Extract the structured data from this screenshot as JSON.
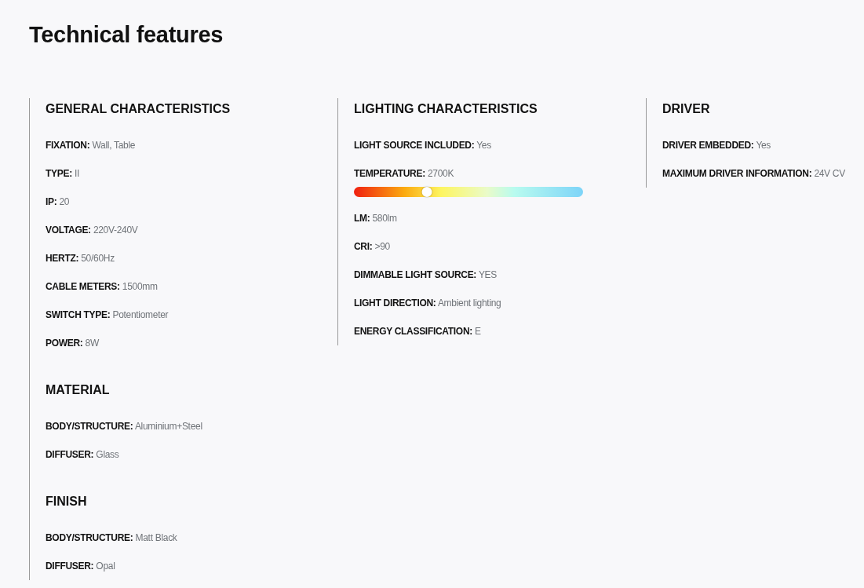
{
  "title": "Technical features",
  "columns": [
    {
      "sections": [
        {
          "title": "GENERAL CHARACTERISTICS",
          "rows": [
            {
              "kind": "text",
              "label": "FIXATION:",
              "value": "Wall, Table"
            },
            {
              "kind": "text",
              "label": "TYPE:",
              "value": "II"
            },
            {
              "kind": "text",
              "label": "IP:",
              "value": "20"
            },
            {
              "kind": "text",
              "label": "VOLTAGE:",
              "value": "220V-240V"
            },
            {
              "kind": "text",
              "label": "HERTZ:",
              "value": "50/60Hz"
            },
            {
              "kind": "text",
              "label": "CABLE METERS:",
              "value": "1500mm"
            },
            {
              "kind": "text",
              "label": "SWITCH TYPE:",
              "value": "Potentiometer"
            },
            {
              "kind": "text",
              "label": "POWER:",
              "value": "8W"
            }
          ]
        },
        {
          "title": "MATERIAL",
          "rows": [
            {
              "kind": "text",
              "label": "BODY/STRUCTURE:",
              "value": "Aluminium+Steel"
            },
            {
              "kind": "text",
              "label": "DIFFUSER:",
              "value": "Glass"
            }
          ]
        },
        {
          "title": "FINISH",
          "rows": [
            {
              "kind": "text",
              "label": "BODY/STRUCTURE:",
              "value": "Matt Black"
            },
            {
              "kind": "text",
              "label": "DIFFUSER:",
              "value": "Opal"
            }
          ]
        }
      ]
    },
    {
      "sections": [
        {
          "title": "LIGHTING CHARACTERISTICS",
          "rows": [
            {
              "kind": "text",
              "label": "LIGHT SOURCE INCLUDED:",
              "value": "Yes"
            },
            {
              "kind": "gradient",
              "label": "TEMPERATURE:",
              "value": "2700K",
              "level": 0.32
            },
            {
              "kind": "text",
              "label": "LM:",
              "value": "580lm"
            },
            {
              "kind": "text",
              "label": "CRI:",
              "value": ">90"
            },
            {
              "kind": "text",
              "label": "DIMMABLE LIGHT SOURCE:",
              "value": "YES"
            },
            {
              "kind": "text",
              "label": "LIGHT DIRECTION:",
              "value": "Ambient lighting"
            },
            {
              "kind": "text",
              "label": "ENERGY CLASSIFICATION:",
              "value": "E"
            }
          ]
        }
      ]
    },
    {
      "sections": [
        {
          "title": "DRIVER",
          "rows": [
            {
              "kind": "text",
              "label": "DRIVER EMBEDDED:",
              "value": "Yes"
            },
            {
              "kind": "text",
              "label": "MAXIMUM DRIVER INFORMATION:",
              "value": "24V CV"
            }
          ]
        }
      ]
    }
  ]
}
